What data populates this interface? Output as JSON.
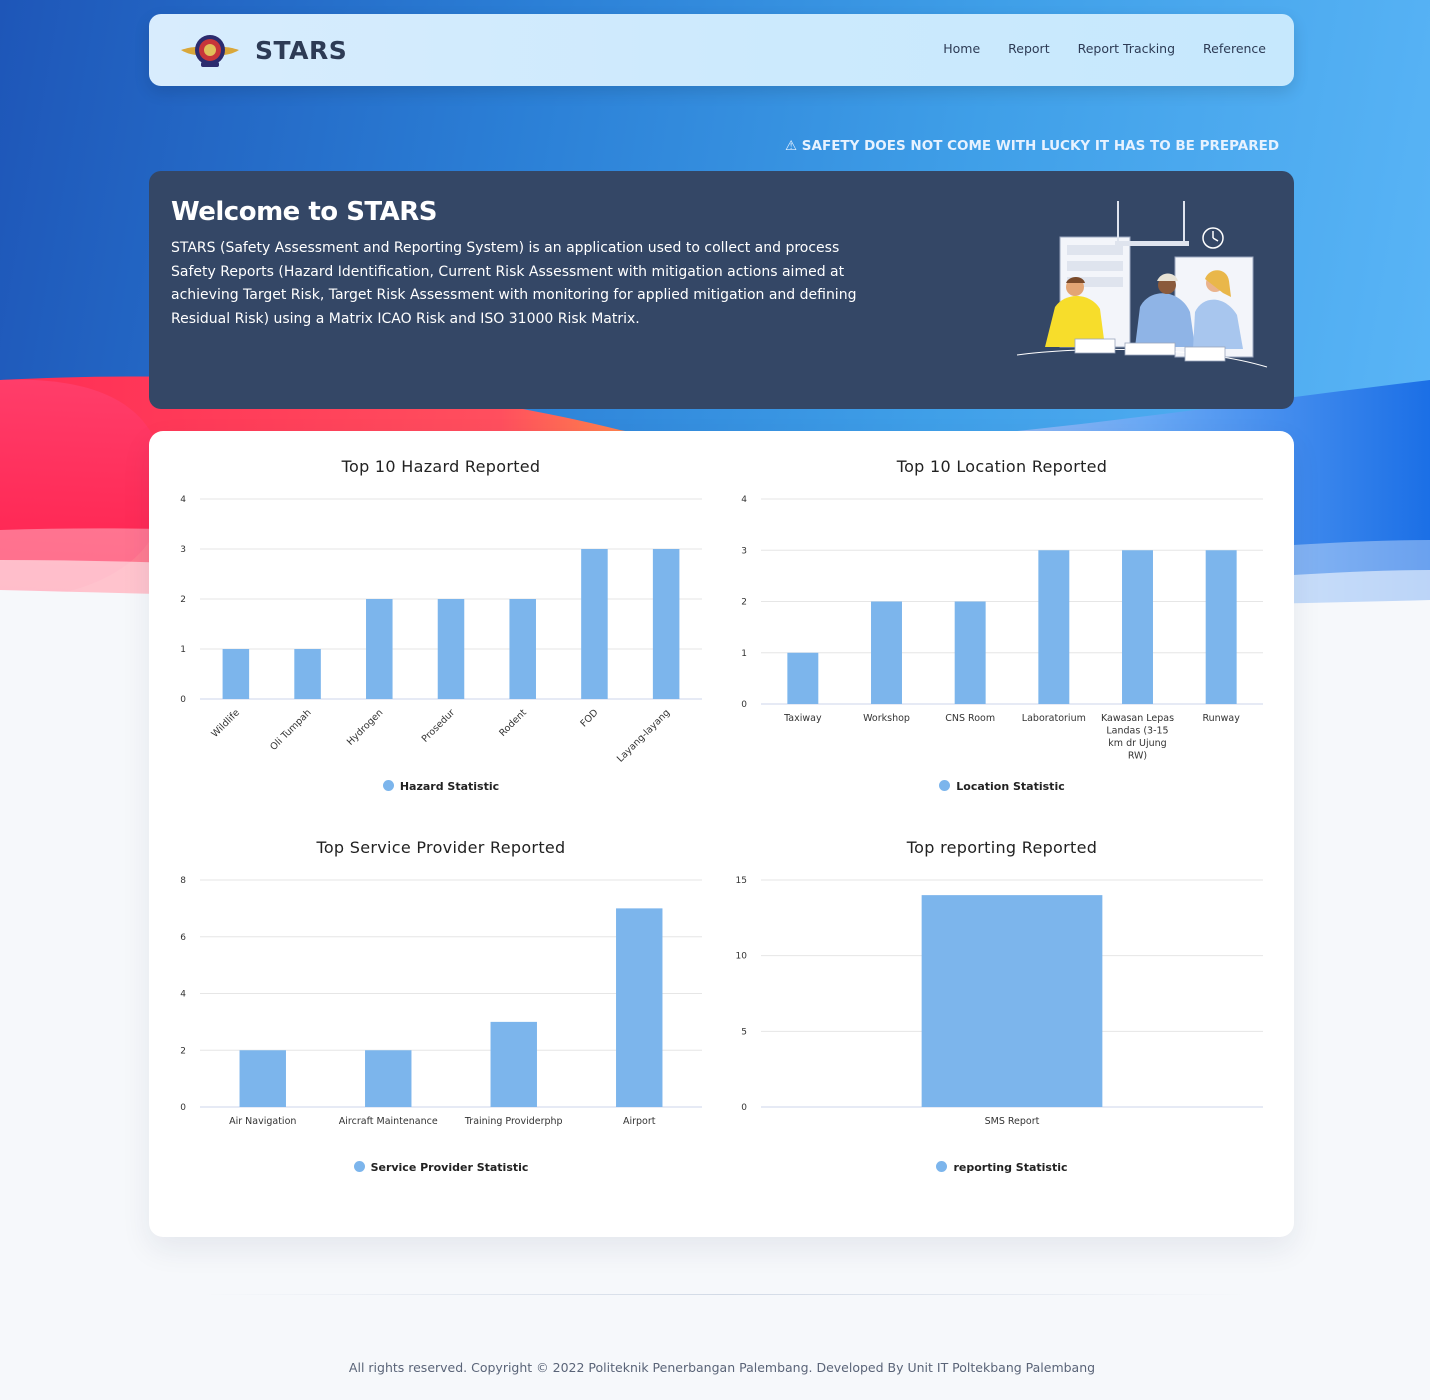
{
  "nav": {
    "brand": "STARS",
    "links": [
      "Home",
      "Report",
      "Report Tracking",
      "Reference"
    ]
  },
  "marquee": {
    "text": "⚠ SAFETY DOES NOT COME WITH LUCKY IT HAS TO BE PREPARED"
  },
  "welcome": {
    "title": "Welcome to STARS",
    "body": "STARS (Safety Assessment and Reporting System) is an application used to collect and process Safety Reports (Hazard Identification, Current Risk Assessment with mitigation actions aimed at achieving Target Risk, Target Risk Assessment with monitoring for applied mitigation and defining Residual Risk) using a Matrix ICAO Risk and ISO 31000 Risk Matrix."
  },
  "colors": {
    "bar": "#7cb5ec",
    "grid": "#e6e6e6",
    "card": "#344766",
    "nav": "#cdeafd"
  },
  "chart_data": [
    {
      "type": "bar",
      "title": "Top 10 Hazard Reported",
      "categories": [
        "Wildlife",
        "Oli Tumpah",
        "Hydrogen",
        "Prosedur",
        "Rodent",
        "FOD",
        "Layang-layang"
      ],
      "series": [
        {
          "name": "Hazard Statistic",
          "values": [
            1,
            1,
            2,
            2,
            2,
            3,
            3
          ]
        }
      ],
      "yticks": [
        0,
        1,
        2,
        3,
        4
      ],
      "ylim": [
        0,
        4
      ],
      "rotate_labels": true
    },
    {
      "type": "bar",
      "title": "Top 10 Location Reported",
      "categories": [
        "Taxiway",
        "Workshop",
        "CNS Room",
        "Laboratorium",
        "Kawasan Lepas Landas (3-15 km dr Ujung RW)",
        "Runway"
      ],
      "series": [
        {
          "name": "Location Statistic",
          "values": [
            1,
            2,
            2,
            3,
            3,
            3
          ]
        }
      ],
      "yticks": [
        0,
        1,
        2,
        3,
        4
      ],
      "ylim": [
        0,
        4
      ],
      "rotate_labels": false
    },
    {
      "type": "bar",
      "title": "Top Service Provider Reported",
      "categories": [
        "Air Navigation",
        "Aircraft Maintenance",
        "Training Providerphp",
        "Airport"
      ],
      "series": [
        {
          "name": "Service Provider Statistic",
          "values": [
            2,
            2,
            3,
            7
          ]
        }
      ],
      "yticks": [
        0,
        2,
        4,
        6,
        8
      ],
      "ylim": [
        0,
        8
      ],
      "rotate_labels": false
    },
    {
      "type": "bar",
      "title": "Top reporting Reported",
      "categories": [
        "SMS Report"
      ],
      "series": [
        {
          "name": "reporting Statistic",
          "values": [
            14
          ]
        }
      ],
      "yticks": [
        0,
        5,
        10,
        15
      ],
      "ylim": [
        0,
        15
      ],
      "rotate_labels": false
    }
  ],
  "footer": {
    "text": "All rights reserved. Copyright © 2022 Politeknik Penerbangan Palembang. Developed By Unit IT Poltekbang Palembang"
  }
}
